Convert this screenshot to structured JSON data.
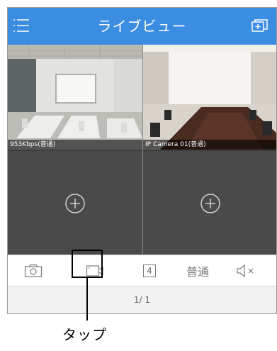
{
  "header": {
    "title": "ライブビュー",
    "menu_icon": "menu-icon",
    "layout_icon": "multi-screen-icon"
  },
  "grid": {
    "tiles": [
      {
        "caption": "953Kbps(普通)",
        "content": "conference-room-camera-feed"
      },
      {
        "caption": "IP Camera 01(普通)",
        "content": "boardroom-camera-feed"
      },
      {
        "caption": "",
        "content": "add-camera"
      },
      {
        "caption": "",
        "content": "add-camera"
      }
    ]
  },
  "toolbar": {
    "snapshot_icon": "camera-icon",
    "record_icon": "video-record-icon",
    "split_label": "4",
    "quality_label": "普通",
    "mute_icon": "speaker-mute-icon"
  },
  "pagination": {
    "text": "1/ 1"
  },
  "annotation": {
    "label": "タップ"
  },
  "colors": {
    "header": "#3a8de0",
    "grid": "#474747",
    "toolbar_icons": "#777777"
  }
}
